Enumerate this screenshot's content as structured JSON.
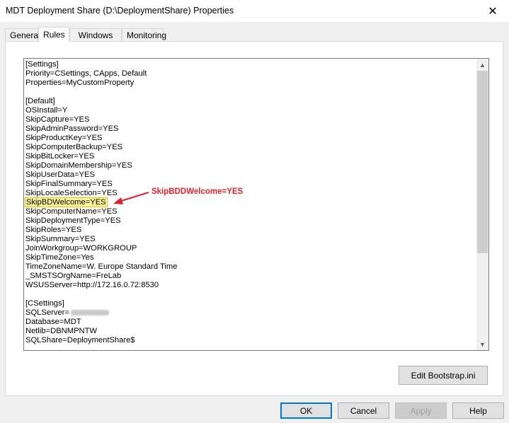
{
  "window": {
    "title": "MDT Deployment Share (D:\\DeploymentShare) Properties",
    "close_glyph": "✕"
  },
  "tabs": [
    {
      "label": "General",
      "active": false
    },
    {
      "label": "Rules",
      "active": true
    },
    {
      "label": "Windows PE",
      "active": false
    },
    {
      "label": "Monitoring",
      "active": false
    }
  ],
  "rules_text": {
    "lines": [
      "[Settings]",
      "Priority=CSettings, CApps, Default",
      "Properties=MyCustomProperty",
      "",
      "[Default]",
      "OSInstall=Y",
      "SkipCapture=YES",
      "SkipAdminPassword=YES",
      "SkipProductKey=YES",
      "SkipComputerBackup=YES",
      "SkipBitLocker=YES",
      "SkipDomainMembership=YES",
      "SkipUserData=YES",
      "SkipFinalSummary=YES",
      "SkipLocaleSelection=YES",
      "SkipBDWelcome=YES",
      "SkipComputerName=YES",
      "SkipDeploymentType=YES",
      "SkipRoles=YES",
      "SkipSummary=YES",
      "JoinWorkgroup=WORKGROUP",
      "SkipTimeZone=Yes",
      "TimeZoneName=W. Europe Standard Time",
      "_SMSTSOrgName=FreLab",
      "WSUSServer=http://172.16.0.72:8530",
      "",
      "[CSettings]",
      "SQLServer=",
      "Database=MDT",
      "Netlib=DBNMPNTW",
      "SQLShare=DeploymentShare$"
    ],
    "highlighted_line": 15,
    "redacted_line": 27
  },
  "annotation": {
    "text": "SkipBDDWelcome=YES",
    "color": "#e0222a"
  },
  "buttons": {
    "edit_bootstrap": "Edit Bootstrap.ini",
    "ok": "OK",
    "cancel": "Cancel",
    "apply": "Apply",
    "help": "Help"
  },
  "scrollbar": {
    "up_glyph": "▲",
    "down_glyph": "▼"
  },
  "colors": {
    "highlight": "#fdf59b",
    "focus_border": "#0078d7"
  }
}
